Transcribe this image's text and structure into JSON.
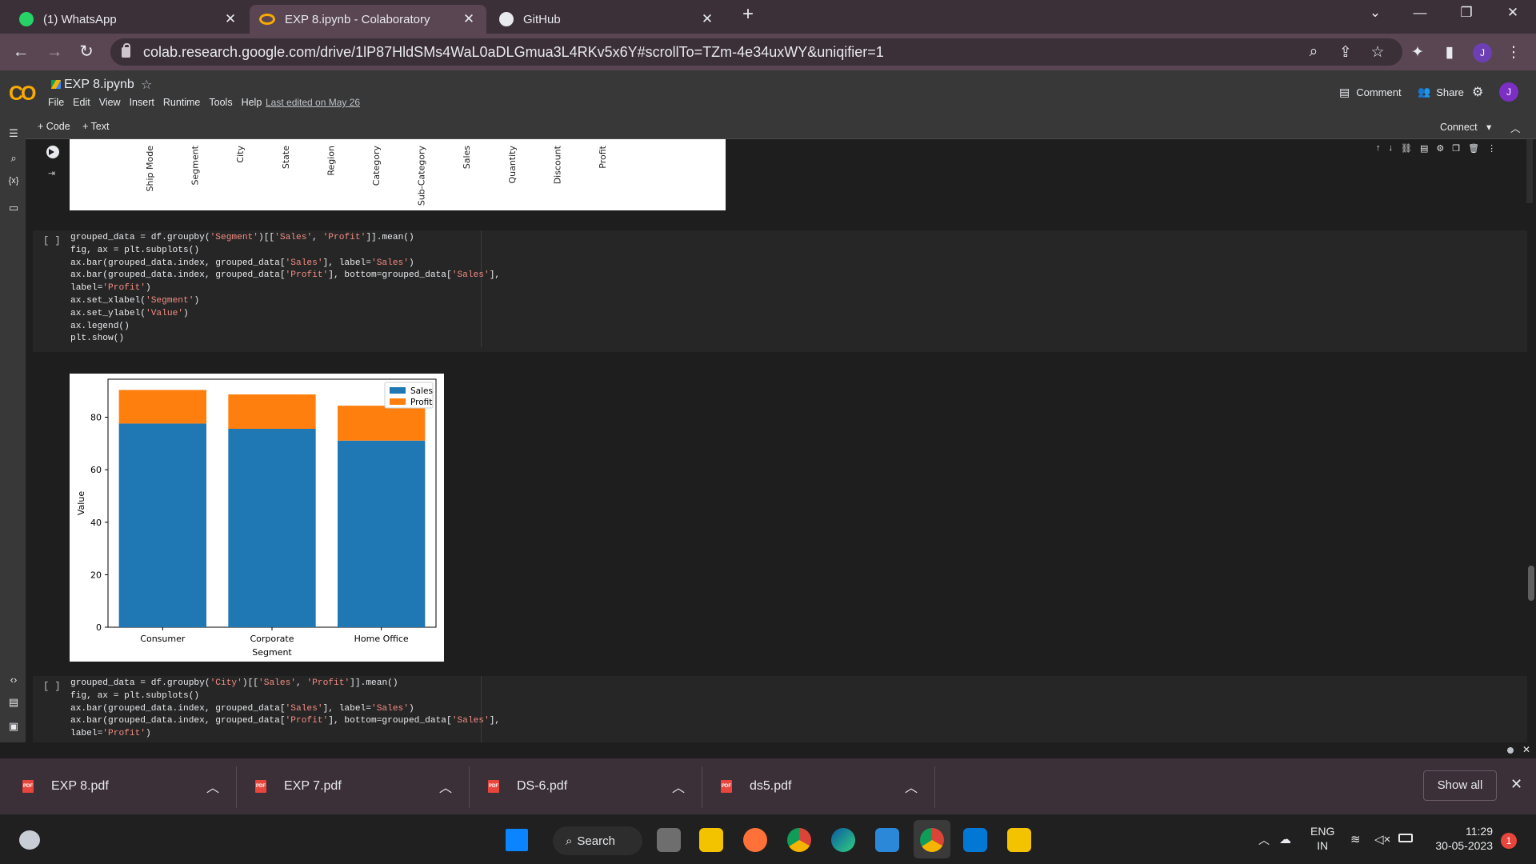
{
  "browser": {
    "tabs": [
      {
        "label": "(1) WhatsApp",
        "icon": "whatsapp-icon"
      },
      {
        "label": "EXP 8.ipynb - Colaboratory",
        "icon": "colab-icon"
      },
      {
        "label": "GitHub",
        "icon": "github-icon"
      }
    ],
    "url": "colab.research.google.com/drive/1lP87HldSMs4WaL0aDLGmua3L4RKv5x6Y#scrollTo=TZm-4e34uxWY&uniqifier=1",
    "profile_initial": "J"
  },
  "colab": {
    "logo": "CO",
    "notebook_title": "EXP 8.ipynb",
    "menu": [
      "File",
      "Edit",
      "View",
      "Insert",
      "Runtime",
      "Tools",
      "Help"
    ],
    "last_edited": "Last edited on May 26",
    "comment_label": "Comment",
    "share_label": "Share",
    "avatar_initial": "J",
    "add_code": "+ Code",
    "add_text": "+ Text",
    "connect_label": "Connect"
  },
  "cells": {
    "prev_output_labels": [
      "Ship Mode",
      "Segment",
      "City",
      "State",
      "Region",
      "Category",
      "Sub-Category",
      "Sales",
      "Quantity",
      "Discount",
      "Profit"
    ],
    "cell1_bracket": "[ ]",
    "cell2_bracket": "[ ]"
  },
  "chart_data": {
    "type": "bar",
    "stacked": true,
    "categories": [
      "Consumer",
      "Corporate",
      "Home Office"
    ],
    "series": [
      {
        "name": "Sales",
        "values": [
          77.6,
          75.6,
          71.1
        ],
        "color": "#1f77b4"
      },
      {
        "name": "Profit",
        "values": [
          12.8,
          13.1,
          13.3
        ],
        "color": "#ff7f0e"
      }
    ],
    "xlabel": "Segment",
    "ylabel": "Value",
    "yticks": [
      0,
      20,
      40,
      60,
      80
    ],
    "ylim": [
      0,
      94.5
    ],
    "legend": "top-right"
  },
  "downloads": {
    "items": [
      "EXP 8.pdf",
      "EXP 7.pdf",
      "DS-6.pdf",
      "ds5.pdf"
    ],
    "show_all": "Show all"
  },
  "taskbar": {
    "search_label": "Search",
    "lang_1": "ENG",
    "lang_2": "IN",
    "time": "11:29",
    "date": "30-05-2023",
    "notif_count": "1"
  }
}
